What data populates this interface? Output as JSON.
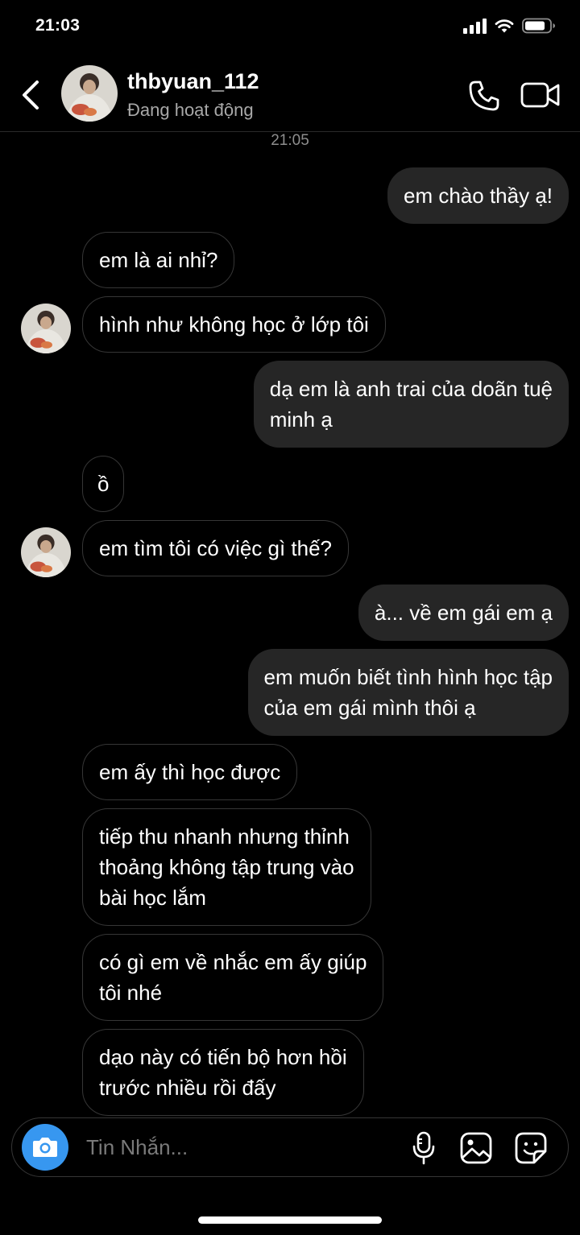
{
  "status_bar": {
    "time": "21:03"
  },
  "header": {
    "username": "thbyuan_112",
    "presence": "Đang hoạt động"
  },
  "conversation": {
    "timestamp": "21:05",
    "messages": [
      {
        "from": "me",
        "text": "em chào thầy ạ!"
      },
      {
        "from": "them",
        "text": "em là ai nhỉ?"
      },
      {
        "from": "them",
        "text": "hình như không học ở lớp tôi"
      },
      {
        "from": "me",
        "text": "dạ em là anh trai của doãn tuệ\nminh ạ"
      },
      {
        "from": "them",
        "text": "ồ"
      },
      {
        "from": "them",
        "text": "em tìm tôi có việc gì thế?"
      },
      {
        "from": "me",
        "text": "à... về em gái em ạ"
      },
      {
        "from": "me",
        "text": "em muốn biết tình hình học tập\ncủa em gái mình thôi ạ"
      },
      {
        "from": "them",
        "text": "em ấy thì học được"
      },
      {
        "from": "them",
        "text": "tiếp thu nhanh nhưng thỉnh\nthoảng không tập trung vào\nbài học lắm"
      },
      {
        "from": "them",
        "text": "có gì em về nhắc em ấy giúp\ntôi nhé"
      },
      {
        "from": "them",
        "text": "dạo này có tiến bộ hơn hồi\ntrước nhiều rồi đấy"
      }
    ]
  },
  "composer": {
    "placeholder": "Tin Nhắn..."
  },
  "colors": {
    "sent_bubble": "#262626",
    "received_border": "#363636",
    "camera_button": "#3797f0",
    "secondary_text": "#a8a8a8"
  },
  "icons": [
    "back-icon",
    "phone-icon",
    "video-camera-icon",
    "camera-icon",
    "microphone-icon",
    "gallery-icon",
    "sticker-icon"
  ]
}
